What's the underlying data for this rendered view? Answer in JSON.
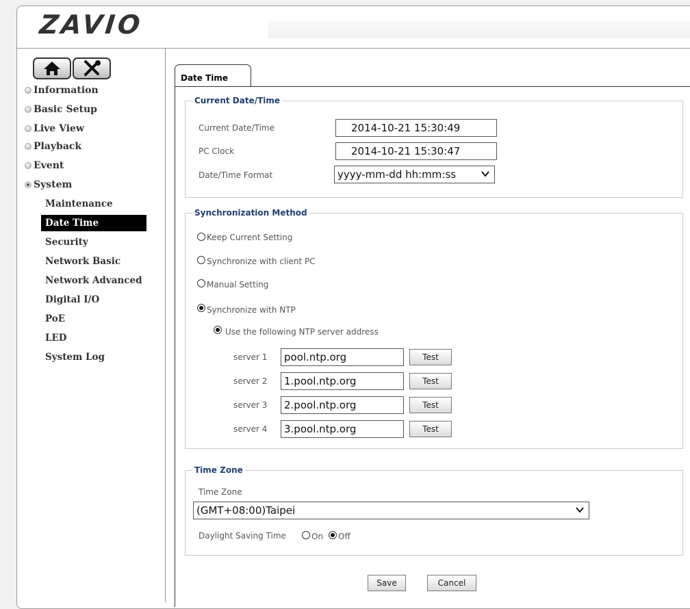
{
  "brand": {
    "logo_text": "ZAVIO"
  },
  "toolbar": {
    "home_icon": "home-icon",
    "settings_icon": "tools-icon"
  },
  "sidebar": {
    "items": [
      {
        "label": "Information",
        "expanded": false
      },
      {
        "label": "Basic Setup",
        "expanded": false
      },
      {
        "label": "Live View",
        "expanded": false
      },
      {
        "label": "Playback",
        "expanded": false
      },
      {
        "label": "Event",
        "expanded": false
      },
      {
        "label": "System",
        "expanded": true
      }
    ],
    "system_subitems": [
      "Maintenance",
      "Date Time",
      "Security",
      "Network Basic",
      "Network Advanced",
      "Digital I/O",
      "PoE",
      "LED",
      "System Log"
    ],
    "active_subitem": "Date Time"
  },
  "tab": {
    "label": "Date Time"
  },
  "current": {
    "legend": "Current Date/Time",
    "current_label": "Current Date/Time",
    "current_value": "2014-10-21   15:30:49",
    "pc_label": "PC Clock",
    "pc_value": "2014-10-21   15:30:47",
    "format_label": "Date/Time Format",
    "format_value": "yyyy-mm-dd hh:mm:ss"
  },
  "sync": {
    "legend": "Synchronization Method",
    "options": [
      {
        "label": "Keep Current Setting",
        "selected": false
      },
      {
        "label": "Synchronize with client PC",
        "selected": false
      },
      {
        "label": "Manual Setting",
        "selected": false
      },
      {
        "label": "Synchronize with NTP",
        "selected": true
      }
    ],
    "ntp_option": "Use the following NTP server address",
    "servers": [
      {
        "label": "server 1",
        "value": "pool.ntp.org"
      },
      {
        "label": "server 2",
        "value": "1.pool.ntp.org"
      },
      {
        "label": "server 3",
        "value": "2.pool.ntp.org"
      },
      {
        "label": "server 4",
        "value": "3.pool.ntp.org"
      }
    ],
    "test_label": "Test"
  },
  "timezone": {
    "legend": "Time Zone",
    "label": "Time Zone",
    "value": "(GMT+08:00)Taipei",
    "dst_label": "Daylight Saving Time",
    "dst_on": "On",
    "dst_off": "Off",
    "dst_selected": "Off"
  },
  "actions": {
    "save": "Save",
    "cancel": "Cancel"
  }
}
